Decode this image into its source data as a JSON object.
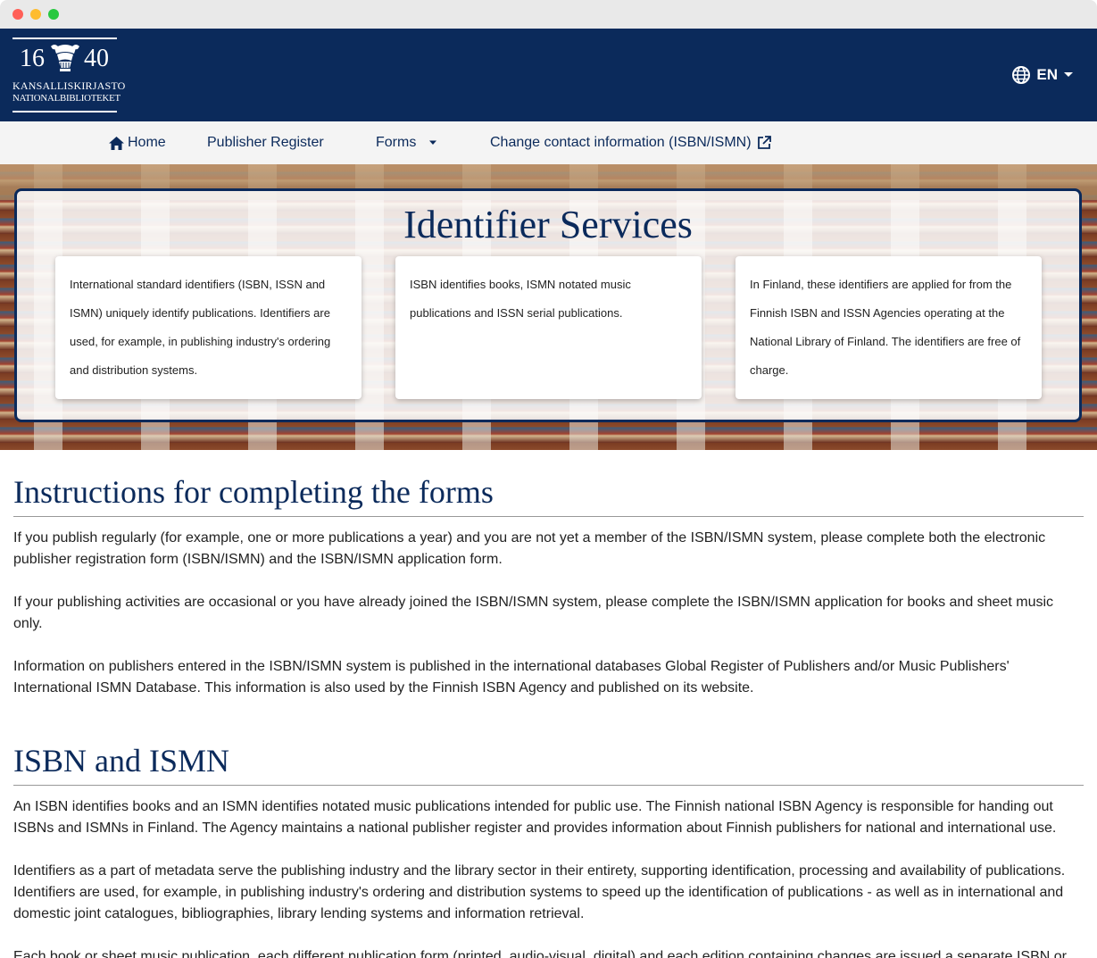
{
  "window": {
    "colors": {
      "close": "#ff5f57",
      "minimize": "#febc2e",
      "maximize": "#28c840"
    }
  },
  "header": {
    "logo": {
      "year_left": "16",
      "year_right": "40",
      "line1": "KANSALLISKIRJASTO",
      "line2": "NATIONALBIBLIOTEKET",
      "icon": "column-capital-crest-icon"
    },
    "language": {
      "label": "EN",
      "icon": "globe-icon",
      "caret_icon": "caret-down-icon"
    },
    "colors": {
      "brand": "#0b2a5b"
    }
  },
  "nav": {
    "home": {
      "label": "Home",
      "icon": "home-icon"
    },
    "publisher_register": {
      "label": "Publisher Register"
    },
    "forms": {
      "label": "Forms",
      "icon": "caret-down-icon"
    },
    "change_contact": {
      "label": "Change contact information (ISBN/ISMN)",
      "icon": "external-link-icon"
    }
  },
  "hero": {
    "title": "Identifier Services",
    "cards": [
      {
        "text": "International standard identifiers (ISBN, ISSN and ISMN) uniquely identify publications. Identifiers are used, for example, in publishing industry's ordering and distribution systems."
      },
      {
        "text": "ISBN identifies books, ISMN notated music publications and ISSN serial publications."
      },
      {
        "text": "In Finland, these identifiers are applied for from the Finnish ISBN and ISSN Agencies operating at the National Library of Finland. The identifiers are free of charge."
      }
    ]
  },
  "instructions": {
    "heading": "Instructions for completing the forms",
    "paragraphs": [
      "If you publish regularly (for example, one or more publications a year) and you are not yet a member of the ISBN/ISMN system, please complete both the electronic publisher registration form (ISBN/ISMN) and the ISBN/ISMN application form.",
      "If your publishing activities are occasional or you have already joined the ISBN/ISMN system, please complete the ISBN/ISMN application for books and sheet music only.",
      "Information on publishers entered in the ISBN/ISMN system is published in the international databases Global Register of Publishers and/or Music Publishers' International ISMN Database. This information is also used by the Finnish ISBN Agency and published on its website."
    ]
  },
  "isbn_ismn": {
    "heading": "ISBN and ISMN",
    "paragraphs": [
      "An ISBN identifies books and an ISMN identifies notated music publications intended for public use. The Finnish national ISBN Agency is responsible for handing out ISBNs and ISMNs in Finland. The Agency maintains a national publisher register and provides information about Finnish publishers for national and international use.",
      "Identifiers as a part of metadata serve the publishing industry and the library sector in their entirety, supporting identification, processing and availability of publications. Identifiers are used, for example, in publishing industry's ordering and distribution systems to speed up the identification of publications - as well as in international and domestic joint catalogues, bibliographies, library lending systems and information retrieval.",
      "Each book or sheet music publication, each different publication form (printed, audio-visual, digital) and each edition containing changes are issued a separate ISBN or ISMN. This promotes identification of publications in the publishing industry's distribution chain and ensures that customers get the desired publication at their"
    ]
  }
}
